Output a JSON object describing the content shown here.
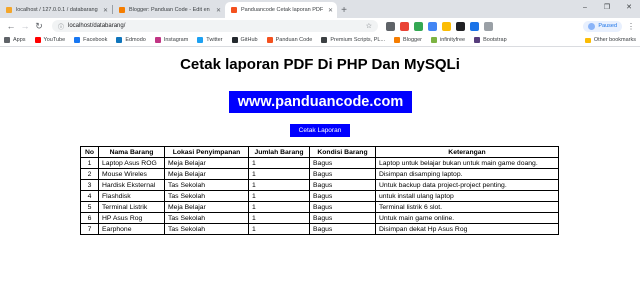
{
  "browser": {
    "tabs": [
      {
        "title": "localhost / 127.0.0.1 / databarang",
        "favicon_color": "#f4a62a"
      },
      {
        "title": "Blogger: Panduan Code - Edit en",
        "favicon_color": "#f57d00"
      },
      {
        "title": "Panduancode Cetak laporan PDF",
        "favicon_color": "#f4511e"
      }
    ],
    "new_tab_glyph": "+",
    "window_controls": [
      "–",
      "❐",
      "✕"
    ],
    "url": "localhost/databarang/",
    "profile_label": "Paused",
    "bookmarks": [
      {
        "label": "Apps",
        "color": "#5f6368"
      },
      {
        "label": "YouTube",
        "color": "#ff0000"
      },
      {
        "label": "Facebook",
        "color": "#1877f2"
      },
      {
        "label": "Edmodo",
        "color": "#0f75bc"
      },
      {
        "label": "Instagram",
        "color": "#c13584"
      },
      {
        "label": "Twitter",
        "color": "#1da1f2"
      },
      {
        "label": "GitHub",
        "color": "#24292e"
      },
      {
        "label": "Panduan Code",
        "color": "#f4511e"
      },
      {
        "label": "Premium Scripts, PL...",
        "color": "#3c4043"
      },
      {
        "label": "Blogger",
        "color": "#f57d00"
      },
      {
        "label": "infinityfree",
        "color": "#7cb342"
      },
      {
        "label": "Bootstrap",
        "color": "#563d7c"
      }
    ],
    "other_bookmarks": "Other bookmarks"
  },
  "page": {
    "title": "Cetak laporan PDF Di PHP Dan MySQLi",
    "banner": "www.panduancode.com",
    "print_button": "Cetak Laporan",
    "table": {
      "headers": [
        "No",
        "Nama Barang",
        "Lokasi Penyimpanan",
        "Jumlah Barang",
        "Kondisi Barang",
        "Keterangan"
      ],
      "rows": [
        [
          "1",
          "Laptop Asus ROG",
          "Meja Belajar",
          "1",
          "Bagus",
          "Laptop untuk belajar bukan untuk main game doang."
        ],
        [
          "2",
          "Mouse Wireles",
          "Meja Belajar",
          "1",
          "Bagus",
          "Disimpan disamping laptop."
        ],
        [
          "3",
          "Hardisk Eksternal",
          "Tas Sekolah",
          "1",
          "Bagus",
          "Untuk backup data project-project penting."
        ],
        [
          "4",
          "Flashdisk",
          "Tas Sekolah",
          "1",
          "Bagus",
          "untuk install ulang laptop"
        ],
        [
          "5",
          "Terminal Listrik",
          "Meja Belajar",
          "1",
          "Bagus",
          "Terminal listrik 6 slot."
        ],
        [
          "6",
          "HP Asus Rog",
          "Tas Sekolah",
          "1",
          "Bagus",
          "Untuk main game online."
        ],
        [
          "7",
          "Earphone",
          "Tas Sekolah",
          "1",
          "Bagus",
          "Disimpan dekat Hp Asus Rog"
        ]
      ]
    }
  }
}
